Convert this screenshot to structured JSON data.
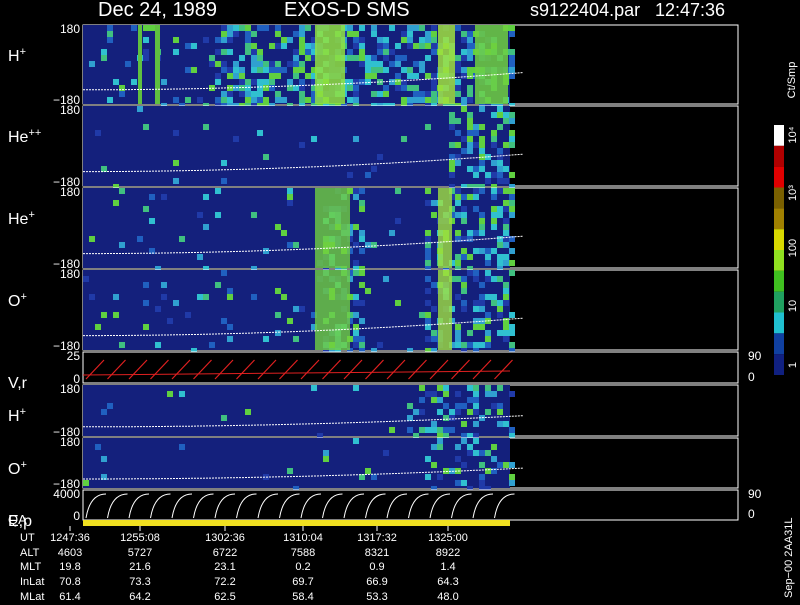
{
  "header": {
    "date": "Dec 24, 1989",
    "instrument": "EXOS-D SMS",
    "file": "s9122404.par",
    "time": "12:47:36"
  },
  "colorbar": {
    "unit_label": "Ct/Smp",
    "tick_labels": [
      "10⁴",
      "10³",
      "100",
      "10",
      "1"
    ],
    "colors": [
      "#ffffff",
      "#b00000",
      "#e00000",
      "#7a6000",
      "#a08000",
      "#d8d800",
      "#90e020",
      "#40c020",
      "#20a060",
      "#20c0d0",
      "#1040a0",
      "#102080"
    ]
  },
  "panels": [
    {
      "id": "h-plus-1",
      "label_base": "H",
      "label_sup": "+",
      "ticks": [
        "180",
        "−180"
      ]
    },
    {
      "id": "he-pp",
      "label_base": "He",
      "label_sup": "++",
      "ticks": [
        "180",
        "−180"
      ]
    },
    {
      "id": "he-plus",
      "label_base": "He",
      "label_sup": "+",
      "ticks": [
        "180",
        "−180"
      ]
    },
    {
      "id": "o-plus-1",
      "label_base": "O",
      "label_sup": "+",
      "ticks": [
        "180",
        "−180"
      ]
    },
    {
      "id": "vr",
      "label_base": "V,r",
      "label_sup": "",
      "ticks": [
        "25",
        "0"
      ],
      "right_ticks": [
        "90",
        "0"
      ]
    },
    {
      "id": "h-plus-2",
      "label_base": "H",
      "label_sup": "+",
      "ticks": [
        "180",
        "−180"
      ]
    },
    {
      "id": "o-plus-2",
      "label_base": "O",
      "label_sup": "+",
      "ticks": [
        "180",
        "−180"
      ]
    },
    {
      "id": "ep",
      "label_base": "E,p",
      "label_sup": "",
      "ticks": [
        "4000",
        "0"
      ],
      "right_ticks": [
        "90",
        "0"
      ]
    }
  ],
  "qa_label": "QA",
  "side_note": "Sep−00  2AA31L",
  "orbit_table": {
    "row_labels": [
      "UT",
      "ALT",
      "MLT",
      "InLat",
      "MLat"
    ],
    "columns": [
      [
        "1247:36",
        "4603",
        "19.8",
        "70.8",
        "61.4"
      ],
      [
        "1255:08",
        "5727",
        "21.6",
        "73.3",
        "64.2"
      ],
      [
        "1302:36",
        "6722",
        "23.1",
        "72.2",
        "62.5"
      ],
      [
        "1310:04",
        "7588",
        "0.2",
        "69.7",
        "58.4"
      ],
      [
        "1317:32",
        "8321",
        "0.9",
        "66.9",
        "53.3"
      ],
      [
        "1325:00",
        "8922",
        "1.4",
        "64.3",
        "48.0"
      ]
    ]
  },
  "chart_data": {
    "type": "heatmap",
    "title": "Dec 24, 1989   EXOS-D SMS",
    "x_ticks": [
      "1247:36",
      "1255:08",
      "1302:36",
      "1310:04",
      "1317:32",
      "1325:00"
    ],
    "panels": [
      "H+",
      "He++",
      "He+",
      "O+",
      "V,r",
      "H+",
      "O+",
      "E,p"
    ],
    "y_ranges": {
      "H+": [
        -180,
        180
      ],
      "He++": [
        -180,
        180
      ],
      "He+": [
        -180,
        180
      ],
      "O+": [
        -180,
        180
      ],
      "V,r": [
        0,
        25
      ],
      "E,p": [
        0,
        4000
      ]
    },
    "colorbar_range": [
      1,
      10000
    ],
    "colorbar_scale": "log"
  }
}
